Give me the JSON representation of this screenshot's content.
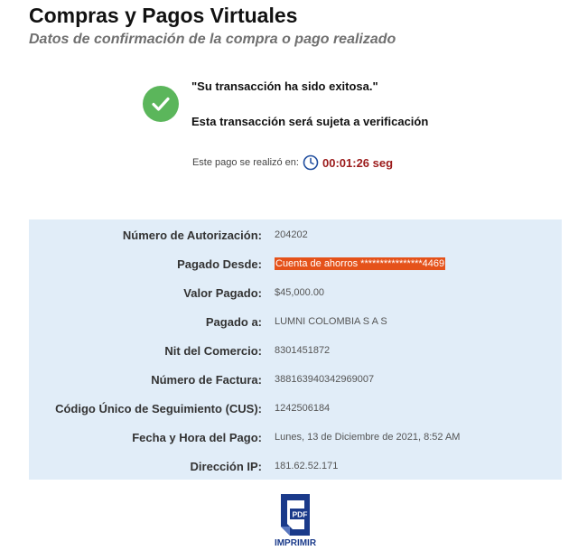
{
  "header": {
    "title": "Compras y Pagos Virtuales",
    "subtitle": "Datos de confirmación de la compra o pago realizado"
  },
  "status": {
    "icon": "check-circle-icon",
    "success_message": "\"Su transacción ha sido exitosa.\"",
    "verification_message": "Esta transacción será sujeta a verificación",
    "time_label": "Este pago se realizó en:",
    "time_icon": "clock-icon",
    "time_value": "00:01:26 seg"
  },
  "details": [
    {
      "label": "Número de Autorización:",
      "value": "204202"
    },
    {
      "label": "Pagado Desde:",
      "value": "Cuenta de ahorros ****************4469",
      "highlight": true
    },
    {
      "label": "Valor Pagado:",
      "value": "$45,000.00"
    },
    {
      "label": "Pagado a:",
      "value": "LUMNI COLOMBIA S A S"
    },
    {
      "label": "Nit del Comercio:",
      "value": "8301451872"
    },
    {
      "label": "Número de Factura:",
      "value": "388163940342969007"
    },
    {
      "label": "Código Único de Seguimiento (CUS):",
      "value": "1242506184"
    },
    {
      "label": "Fecha y Hora del Pago:",
      "value": "Lunes, 13 de Diciembre de 2021, 8:52 AM"
    },
    {
      "label": "Dirección IP:",
      "value": "181.62.52.171"
    }
  ],
  "print": {
    "icon": "pdf-icon",
    "icon_text": "PDF",
    "label": "IMPRIMIR"
  },
  "colors": {
    "success": "#5bb65b",
    "time_value": "#9b1b1b",
    "panel_bg": "#e1edf8",
    "highlight": "#e5521a",
    "print_blue": "#1a3a8a"
  }
}
